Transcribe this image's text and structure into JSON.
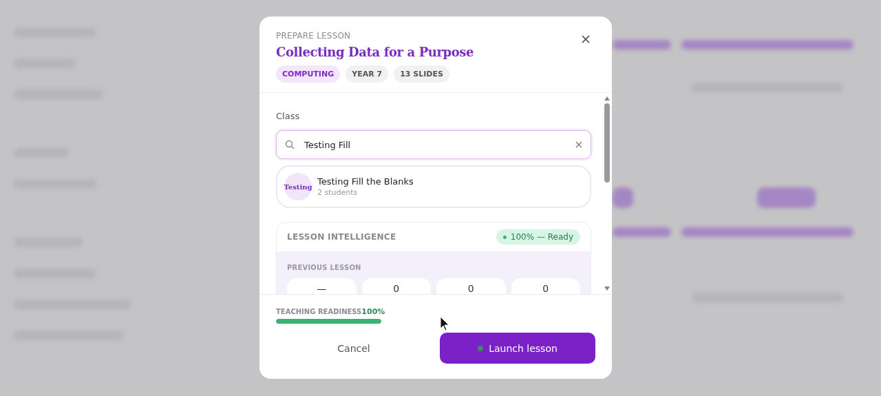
{
  "header": {
    "eyebrow": "PREPARE LESSON",
    "title": "Collecting Data for a Purpose",
    "tags": [
      {
        "label": "COMPUTING",
        "kind": "subject"
      },
      {
        "label": "YEAR 7",
        "kind": "meta"
      },
      {
        "label": "13 SLIDES",
        "kind": "meta"
      }
    ]
  },
  "class_picker": {
    "label": "Class",
    "search": {
      "value": "Testing Fill"
    },
    "results": [
      {
        "avatar": "Testing",
        "name": "Testing Fill the Blanks",
        "detail": "2 students"
      }
    ]
  },
  "lesson_intelligence": {
    "title": "LESSON INTELLIGENCE",
    "status": "100% — Ready",
    "section": "PREVIOUS LESSON",
    "stats": [
      "—",
      "0",
      "0",
      "0"
    ]
  },
  "footer": {
    "readiness": {
      "label": "TEACHING READINESS",
      "value": "100%",
      "level": 1
    },
    "buttons": [
      {
        "label": "Cancel",
        "kind": "secondary"
      },
      {
        "label": "Launch lesson",
        "kind": "primary"
      }
    ]
  }
}
